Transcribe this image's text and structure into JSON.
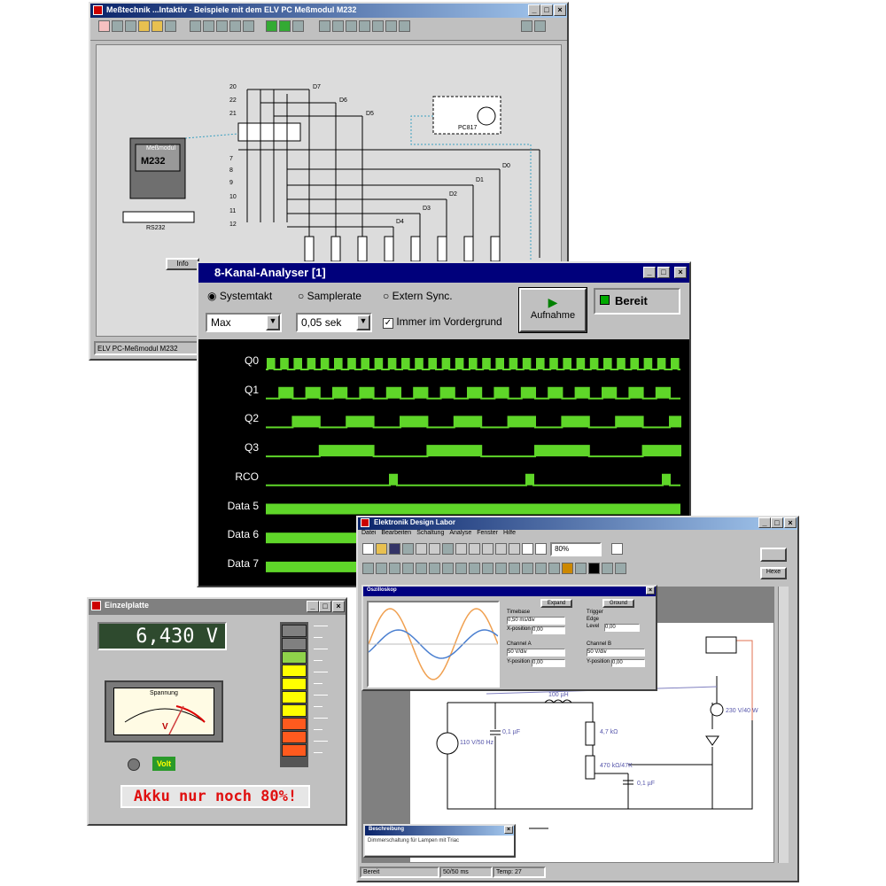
{
  "w1": {
    "title": "Meßtechnik ...Intaktiv - Beispiele mit dem ELV PC Meßmodul M232",
    "module": "M232",
    "module_top": "Meßmodul",
    "module_small": "M232",
    "rs": "RS232",
    "pc": "PC817",
    "status": "ELV PC-Meßmodul M232",
    "info": "Info",
    "io": [
      "D7",
      "D6",
      "D5",
      "D4",
      "D3",
      "D2",
      "D1",
      "D0"
    ],
    "pins": [
      "20",
      "22",
      "21",
      "7",
      "8",
      "9",
      "10",
      "11",
      "12"
    ]
  },
  "w2": {
    "title": "8-Kanal-Analyser [1]",
    "radio1": "Systemtakt",
    "radio2": "Samplerate",
    "radio3": "Extern Sync.",
    "sel1": "Max",
    "sel2": "0,05 sek",
    "check": "Immer im Vordergrund",
    "record": "Aufnahme",
    "status": "Bereit",
    "channels": [
      "Q0",
      "Q1",
      "Q2",
      "Q3",
      "RCO",
      "Data 5",
      "Data 6",
      "Data 7"
    ],
    "color": "#5fd629"
  },
  "w3": {
    "title": "Einzelplatte",
    "value": "6,430 V",
    "mode": "Volt",
    "scale": "Spannung",
    "unit": "V",
    "message": "Akku nur noch 80%!",
    "bar_colors": [
      "#808080",
      "#808080",
      "#8fd24a",
      "#ffff00",
      "#ffff00",
      "#ffff00",
      "#ffff00",
      "#ff5a1e",
      "#ff5a1e",
      "#ff5a1e"
    ]
  },
  "w4": {
    "title": "Elektronik Design Labor",
    "menu": [
      "Datei",
      "Bearbeiten",
      "Schaltung",
      "Analyse",
      "Fenster",
      "Hilfe"
    ],
    "zoom": "80%",
    "print_btn": "Hexe",
    "c1": "100 µH",
    "c2": "0,1 µF",
    "c3": "4,7 kΩ",
    "c4": "230 V/40 W",
    "c5": "470 kΩ/47K",
    "c6": "0,1 µF",
    "c7": "110 V/50 Hz",
    "status": [
      "Bereit",
      "50/50 ms",
      "Temp: 27"
    ],
    "note_title": "Beschreibung",
    "note": "Dimmerschaltung für Lampen mit Triac"
  },
  "scope": {
    "title": "Oszilloskop",
    "expand": "Expand",
    "ground": "Ground",
    "timebase": "Timebase",
    "trigger": "Trigger",
    "ch_a": "Channel A",
    "ch_b": "Channel B",
    "tb_val": "0,50 ms/div",
    "xpos": "X-position",
    "ypos": "Y-position",
    "level": "Level",
    "edge": "Edge",
    "ch_a_val": "50 V/div",
    "ch_b_val": "50 V/div",
    "ypos_a": "0,00",
    "ypos_b": "0,00",
    "xpos_val": "0,00",
    "level_val": "0,00"
  },
  "help": {
    "title": "Beschreibung"
  }
}
